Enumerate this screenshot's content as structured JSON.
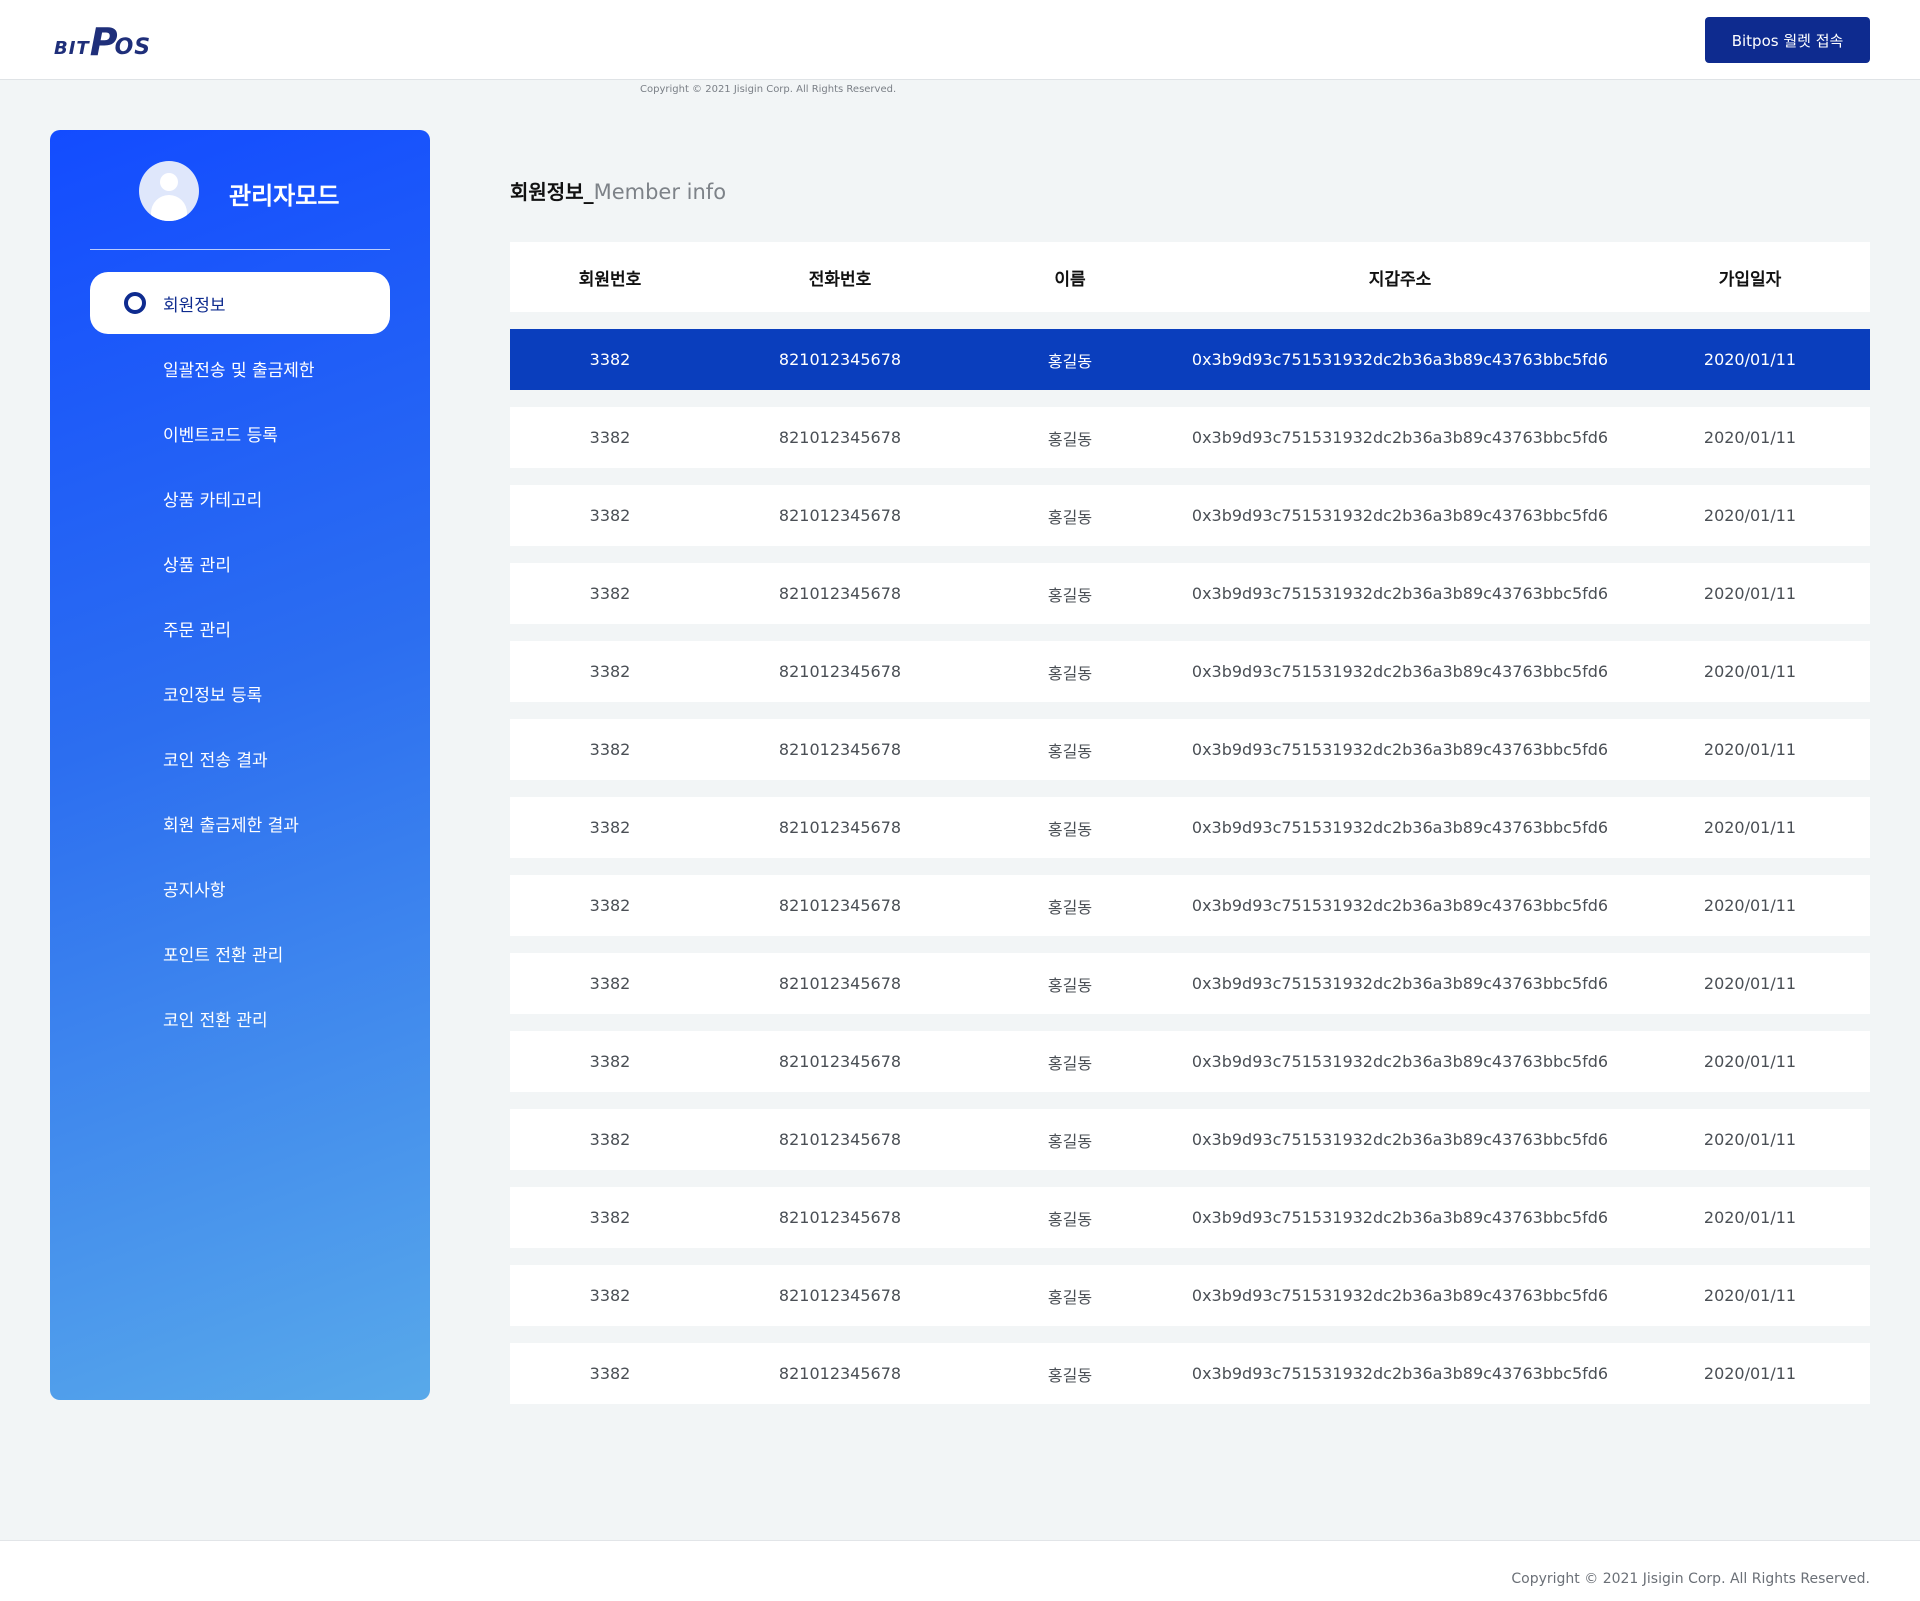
{
  "header": {
    "logo_bit": "BIT",
    "logo_p": "P",
    "logo_os": "OS",
    "wallet_button": "Bitpos 월렛 접속",
    "copyright_small": "Copyright © 2021 Jisigin Corp. All Rights Reserved."
  },
  "sidebar": {
    "title": "관리자모드",
    "items": [
      {
        "label": "회원정보"
      },
      {
        "label": "일괄전송 및 출금제한"
      },
      {
        "label": "이벤트코드 등록"
      },
      {
        "label": "상품 카테고리"
      },
      {
        "label": "상품 관리"
      },
      {
        "label": "주문 관리"
      },
      {
        "label": "코인정보 등록"
      },
      {
        "label": "코인 전송 결과"
      },
      {
        "label": "회원 출금제한 결과"
      },
      {
        "label": "공지사항"
      },
      {
        "label": "포인트 전환 관리"
      },
      {
        "label": "코인 전환 관리"
      }
    ],
    "active_index": 0
  },
  "main": {
    "title_ko": "회원정보_",
    "title_en": "Member info",
    "columns": [
      "회원번호",
      "전화번호",
      "이름",
      "지갑주소",
      "가입일자"
    ],
    "rows": [
      [
        "3382",
        "821012345678",
        "홍길동",
        "0x3b9d93c751531932dc2b36a3b89c43763bbc5fd6",
        "2020/01/11"
      ],
      [
        "3382",
        "821012345678",
        "홍길동",
        "0x3b9d93c751531932dc2b36a3b89c43763bbc5fd6",
        "2020/01/11"
      ],
      [
        "3382",
        "821012345678",
        "홍길동",
        "0x3b9d93c751531932dc2b36a3b89c43763bbc5fd6",
        "2020/01/11"
      ],
      [
        "3382",
        "821012345678",
        "홍길동",
        "0x3b9d93c751531932dc2b36a3b89c43763bbc5fd6",
        "2020/01/11"
      ],
      [
        "3382",
        "821012345678",
        "홍길동",
        "0x3b9d93c751531932dc2b36a3b89c43763bbc5fd6",
        "2020/01/11"
      ],
      [
        "3382",
        "821012345678",
        "홍길동",
        "0x3b9d93c751531932dc2b36a3b89c43763bbc5fd6",
        "2020/01/11"
      ],
      [
        "3382",
        "821012345678",
        "홍길동",
        "0x3b9d93c751531932dc2b36a3b89c43763bbc5fd6",
        "2020/01/11"
      ],
      [
        "3382",
        "821012345678",
        "홍길동",
        "0x3b9d93c751531932dc2b36a3b89c43763bbc5fd6",
        "2020/01/11"
      ],
      [
        "3382",
        "821012345678",
        "홍길동",
        "0x3b9d93c751531932dc2b36a3b89c43763bbc5fd6",
        "2020/01/11"
      ],
      [
        "3382",
        "821012345678",
        "홍길동",
        "0x3b9d93c751531932dc2b36a3b89c43763bbc5fd6",
        "2020/01/11"
      ],
      [
        "3382",
        "821012345678",
        "홍길동",
        "0x3b9d93c751531932dc2b36a3b89c43763bbc5fd6",
        "2020/01/11"
      ],
      [
        "3382",
        "821012345678",
        "홍길동",
        "0x3b9d93c751531932dc2b36a3b89c43763bbc5fd6",
        "2020/01/11"
      ],
      [
        "3382",
        "821012345678",
        "홍길동",
        "0x3b9d93c751531932dc2b36a3b89c43763bbc5fd6",
        "2020/01/11"
      ],
      [
        "3382",
        "821012345678",
        "홍길동",
        "0x3b9d93c751531932dc2b36a3b89c43763bbc5fd6",
        "2020/01/11"
      ]
    ],
    "selected_row": 0
  },
  "footer": {
    "copyright": "Copyright © 2021 Jisigin Corp. All Rights Reserved."
  },
  "colors": {
    "brand_navy": "#0e2b8f",
    "selected_row": "#0a3ebd",
    "sidebar_top": "#134cff",
    "sidebar_bottom": "#58a9ea",
    "page_bg": "#f2f5f6"
  }
}
